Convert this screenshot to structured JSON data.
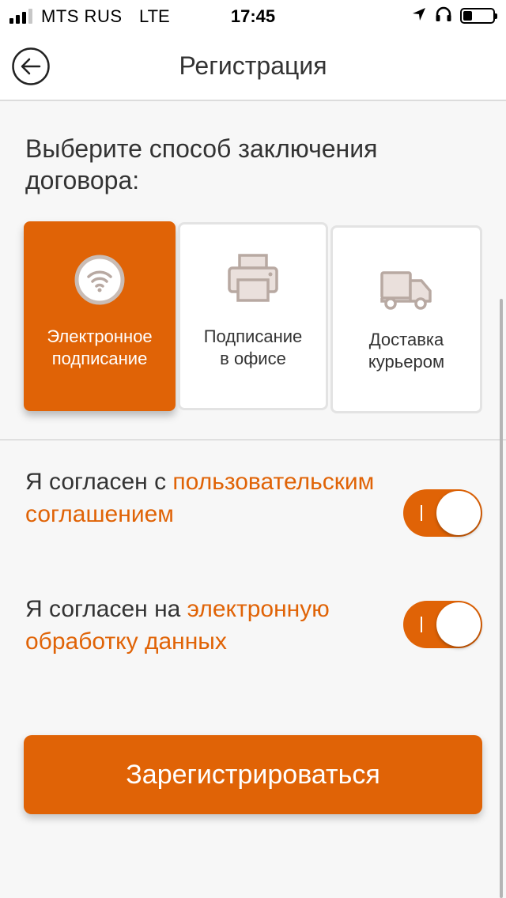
{
  "status_bar": {
    "carrier": "MTS RUS",
    "network": "LTE",
    "time": "17:45",
    "signal_bars_filled": 3,
    "signal_bars_total": 4,
    "battery_level": 0.3,
    "icons": [
      "location-arrow-icon",
      "headphones-icon",
      "battery-icon"
    ]
  },
  "header": {
    "title": "Регистрация",
    "back_icon": "back-arrow-circle-icon"
  },
  "form": {
    "section_title": "Выберите способ заключения договора:",
    "methods": [
      {
        "label": "Электронное\nподписание",
        "icon": "wifi-circle-icon",
        "selected": true
      },
      {
        "label": "Подписание\nв офисе",
        "icon": "printer-icon",
        "selected": false
      },
      {
        "label": "Доставка\nкурьером",
        "icon": "delivery-truck-icon",
        "selected": false
      }
    ],
    "consents": [
      {
        "prefix": "Я согласен с ",
        "link": "пользовательским соглашением",
        "toggle_on": true
      },
      {
        "prefix": "Я согласен на ",
        "link": "электронную обработку данных",
        "toggle_on": true
      }
    ],
    "submit_label": "Зарегистрироваться"
  },
  "colors": {
    "accent": "#e06306",
    "text": "#333333",
    "background": "#f7f7f7",
    "card_border": "#e3e3e3",
    "icon_muted": "#b8a9a2",
    "icon_fill": "#eae0dc"
  }
}
